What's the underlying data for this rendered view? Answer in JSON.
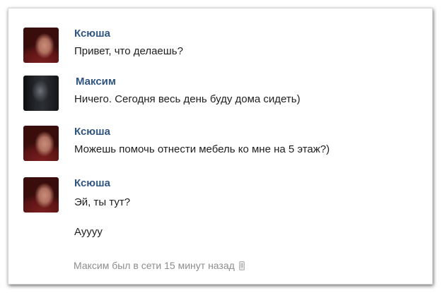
{
  "messages": [
    {
      "author": "Ксюша",
      "avatar": "user-photo",
      "lines": [
        "Привет, что делаешь?"
      ]
    },
    {
      "author": "Максим",
      "avatar": "user-photo",
      "lines": [
        "Ничего. Сегодня весь день буду дома сидеть)"
      ]
    },
    {
      "author": "Ксюша",
      "avatar": "user-photo",
      "lines": [
        "Можешь помочь отнести мебель ко мне на 5 этаж?)"
      ]
    },
    {
      "author": "Ксюша",
      "avatar": "user-photo",
      "lines": [
        "Эй, ты тут?",
        "Ауууу"
      ]
    }
  ],
  "status": {
    "text": "Максим был в сети 15 минут назад",
    "icon": "mobile-phone-icon"
  },
  "colors": {
    "author_name": "#2f5581",
    "message_text": "#1e1e1e",
    "status_text": "#8d8d8d"
  }
}
